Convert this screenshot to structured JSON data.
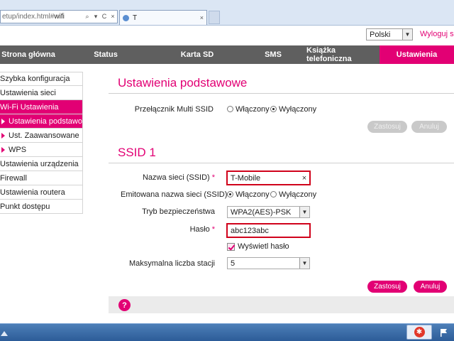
{
  "browser": {
    "address_prefix": "etup/index.html#",
    "address_hash": "wifi",
    "address_buttons": [
      "⌕",
      "▾",
      "C",
      "×"
    ],
    "tab_title": "T",
    "tab_close": "×"
  },
  "header": {
    "language": "Polski",
    "logout": "Wyloguj się"
  },
  "nav": {
    "items": [
      {
        "label": "Strona główna",
        "active": false
      },
      {
        "label": "Status",
        "active": false
      },
      {
        "label": "Karta SD",
        "active": false
      },
      {
        "label": "SMS",
        "active": false
      },
      {
        "label": "Książka telefoniczna",
        "active": false
      },
      {
        "label": "Ustawienia",
        "active": true
      }
    ]
  },
  "sidebar": {
    "items": [
      {
        "label": "Szybka konfiguracja",
        "active": false,
        "sub": false
      },
      {
        "label": "Ustawienia sieci",
        "active": false,
        "sub": false
      },
      {
        "label": "Wi-Fi Ustawienia",
        "active": true,
        "sub": false
      },
      {
        "label": "Ustawienia podstawowe",
        "active": true,
        "sub": true
      },
      {
        "label": "Ust. Zaawansowane",
        "active": false,
        "sub": true
      },
      {
        "label": "WPS",
        "active": false,
        "sub": true
      },
      {
        "label": "Ustawienia urządzenia",
        "active": false,
        "sub": false
      },
      {
        "label": "Firewall",
        "active": false,
        "sub": false
      },
      {
        "label": "Ustawienia routera",
        "active": false,
        "sub": false
      },
      {
        "label": "Punkt dostępu",
        "active": false,
        "sub": false
      }
    ]
  },
  "basic": {
    "title": "Ustawienia podstawowe",
    "multi_ssid_label": "Przełącznik Multi SSID",
    "on_label": "Włączony",
    "off_label": "Wyłączony",
    "multi_ssid_value": "off",
    "apply": "Zastosuj",
    "cancel": "Anuluj"
  },
  "ssid": {
    "title": "SSID 1",
    "name_label": "Nazwa sieci (SSID)",
    "name_value": "T-Mobile",
    "clear": "×",
    "broadcast_label": "Emitowana nazwa sieci (SSID)",
    "broadcast_on": "Włączony",
    "broadcast_off": "Wyłączony",
    "broadcast_value": "on",
    "security_label": "Tryb bezpieczeństwa",
    "security_value": "WPA2(AES)-PSK",
    "password_label": "Hasło",
    "password_value": "abc123abc",
    "show_password_label": "Wyświetl hasło",
    "max_stations_label": "Maksymalna liczba stacji",
    "max_stations_value": "5",
    "required_mark": "*",
    "apply": "Zastosuj",
    "cancel": "Anuluj"
  },
  "footer": {
    "help": "?"
  },
  "colors": {
    "accent": "#e20074",
    "nav_bg": "#5f5f5f",
    "highlight_border": "#d0021b"
  }
}
